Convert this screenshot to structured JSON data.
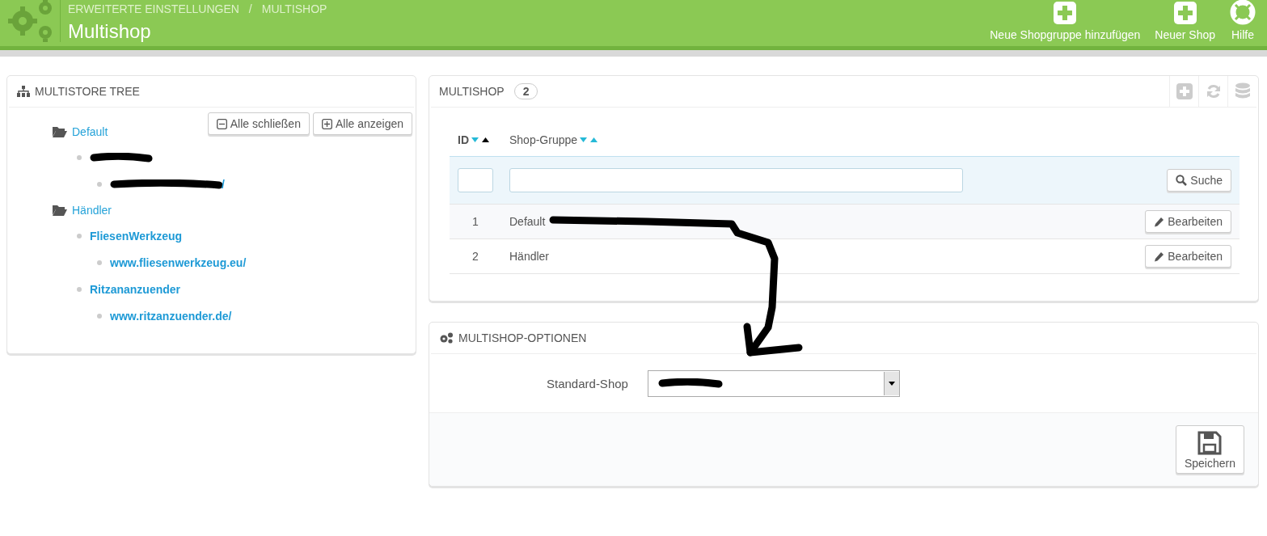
{
  "header": {
    "breadcrumb": [
      "ERWEITERTE EINSTELLUNGEN",
      "MULTISHOP"
    ],
    "separator": "/",
    "title": "Multishop",
    "actions": [
      {
        "label": "Neue Shopgruppe hinzufügen",
        "kind": "add"
      },
      {
        "label": "Neuer Shop",
        "kind": "add"
      },
      {
        "label": "Hilfe",
        "kind": "help"
      }
    ]
  },
  "tree_panel": {
    "title": "MULTISTORE TREE",
    "buttons": [
      {
        "label": "Alle schließen",
        "kind": "collapse"
      },
      {
        "label": "Alle anzeigen",
        "kind": "expand"
      }
    ],
    "groups": [
      {
        "kind": "group",
        "label": "Default",
        "children": [
          {
            "kind": "redacted",
            "children": [
              {
                "kind": "redacted",
                "label": "/"
              }
            ]
          }
        ]
      },
      {
        "kind": "group",
        "label": "Händler",
        "children": [
          {
            "kind": "shop",
            "label": "FliesenWerkzeug",
            "children": [
              {
                "kind": "url",
                "label": "www.fliesenwerkzeug.eu/"
              }
            ]
          },
          {
            "kind": "shop",
            "label": "Ritzananzuender",
            "children": [
              {
                "kind": "url",
                "label": "www.ritzanzuender.de/"
              }
            ]
          }
        ]
      }
    ]
  },
  "shop_panel": {
    "title": "MULTISHOP",
    "count": "2",
    "columns": [
      {
        "label": "ID",
        "sorted_ascending": true
      },
      {
        "label": "Shop-Gruppe",
        "sorted_ascending": false
      }
    ],
    "search_button": "Suche",
    "rows": [
      {
        "id": "1",
        "name": "Default",
        "action": "Bearbeiten"
      },
      {
        "id": "2",
        "name": "Händler",
        "action": "Bearbeiten"
      }
    ]
  },
  "options_panel": {
    "title": "MULTISHOP-OPTIONEN",
    "field_label": "Standard-Shop",
    "select": {
      "kind": "redacted"
    },
    "save_button": "Speichern"
  },
  "annotations": [
    {
      "kind": "arrow"
    }
  ]
}
